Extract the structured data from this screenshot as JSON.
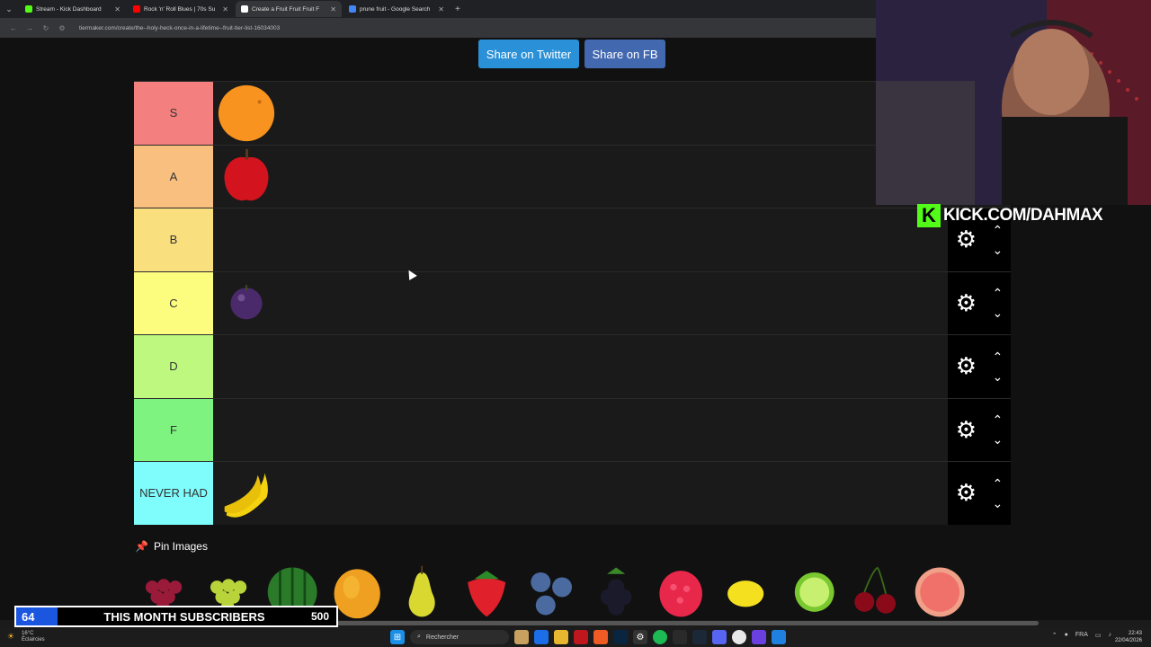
{
  "browser": {
    "tabs": [
      {
        "title": "Stream - Kick Dashboard",
        "color": "#53fc18",
        "active": false
      },
      {
        "title": "Rock 'n' Roll Blues | 70s Su",
        "color": "#ff0000",
        "active": false
      },
      {
        "title": "Create a Fruit Fruit Fruit F",
        "color": "#ffffff",
        "active": true
      },
      {
        "title": "prune fruit - Google Search",
        "color": "#4285f4",
        "active": false
      }
    ],
    "url": "tiermaker.com/create/the--holy-heck-once-in-a-lifetime--fruit-tier-list-16034003"
  },
  "share": {
    "twitter": "Share on Twitter",
    "facebook": "Share on FB"
  },
  "tiers": [
    {
      "label": "S",
      "color": "#f37f7f",
      "items": [
        "orange"
      ]
    },
    {
      "label": "A",
      "color": "#f9bf7f",
      "items": [
        "apple"
      ]
    },
    {
      "label": "B",
      "color": "#fadf7f",
      "items": []
    },
    {
      "label": "C",
      "color": "#fcfd7f",
      "items": [
        "plum"
      ]
    },
    {
      "label": "D",
      "color": "#bff87f",
      "items": []
    },
    {
      "label": "F",
      "color": "#7ff37f",
      "items": []
    },
    {
      "label": "NEVER HAD",
      "color": "#7ffcfc",
      "items": [
        "banana"
      ]
    }
  ],
  "pin_images": {
    "label": "Pin Images"
  },
  "tray": [
    "grapes-red",
    "grapes-green",
    "watermelon",
    "mango",
    "pear",
    "strawberry",
    "blueberries",
    "blackberry",
    "raspberry",
    "lemon",
    "lime",
    "cherries",
    "grapefruit"
  ],
  "overlay": {
    "kick_url": "KICK.COM/DAHMAX",
    "subs_count": "64",
    "subs_label": "THIS MONTH SUBSCRIBERS",
    "subs_goal": "500"
  },
  "taskbar": {
    "weather_temp": "16°C",
    "weather_desc": "Éclaircies",
    "search": "Rechercher",
    "lang": "FRA",
    "time": "22:43",
    "date": "22/04/2026"
  }
}
